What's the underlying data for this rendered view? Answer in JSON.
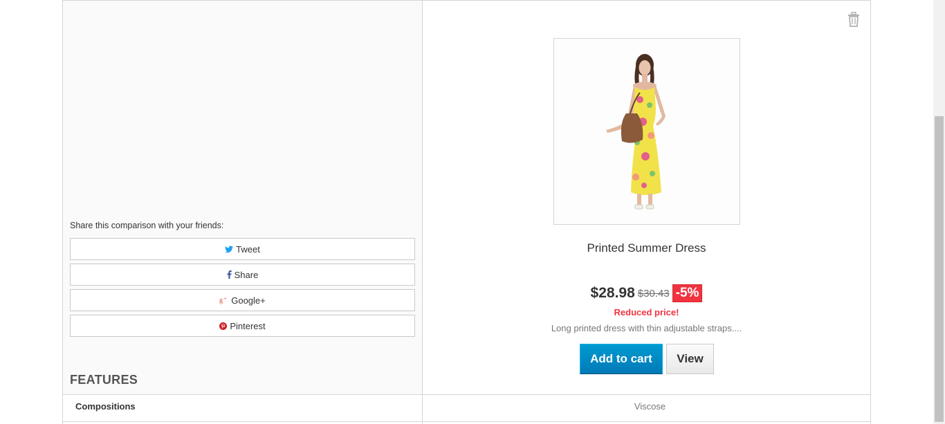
{
  "share": {
    "title": "Share this comparison with your friends:",
    "buttons": [
      {
        "label": "Tweet",
        "icon": "twitter-icon",
        "color": "#1da1f2"
      },
      {
        "label": "Share",
        "icon": "facebook-icon",
        "color": "#3b5998"
      },
      {
        "label": "Google+",
        "icon": "google-plus-icon",
        "color": "#dd4b39"
      },
      {
        "label": "Pinterest",
        "icon": "pinterest-icon",
        "color": "#cb2027"
      }
    ]
  },
  "features": {
    "title": "FEATURES",
    "rows": [
      {
        "label": "Compositions",
        "value": "Viscose"
      }
    ]
  },
  "product": {
    "name": "Printed Summer Dress",
    "price": "$28.98",
    "old_price": "$30.43",
    "discount": "-5%",
    "reduced_label": "Reduced price!",
    "description": "Long printed dress with thin adjustable straps....",
    "add_to_cart_label": "Add to cart",
    "view_label": "View"
  },
  "colors": {
    "accent": "#0e8ed1",
    "sale": "#f13340"
  }
}
